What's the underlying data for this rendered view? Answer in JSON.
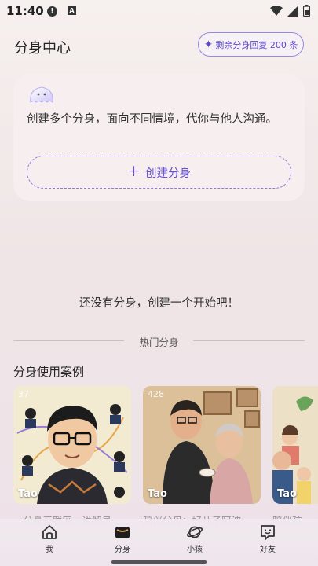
{
  "status_bar": {
    "time": "11:40",
    "badge1": "!",
    "badge2": "A"
  },
  "header": {
    "title": "分身中心",
    "quota_label": "剩余分身回复 200 条"
  },
  "create_card": {
    "description": "创建多个分身，面向不同情境，代你与他人沟通。",
    "button_label": "创建分身"
  },
  "empty_state": {
    "text": "还没有分身，创建一个开始吧！"
  },
  "hot_divider": {
    "label": "热门分身"
  },
  "cases": {
    "title": "分身使用案例",
    "items": [
      {
        "name": "Tao",
        "counter": "37",
        "title": "「分身互联网」讲解员"
      },
      {
        "name": "Tao",
        "counter": "428",
        "title": "陪伴父母：好儿子阿波"
      },
      {
        "name": "Tao",
        "counter": "",
        "title": "陪伴孩"
      }
    ]
  },
  "nav": {
    "items": [
      {
        "label": "我"
      },
      {
        "label": "分身"
      },
      {
        "label": "小猿"
      },
      {
        "label": "好友"
      }
    ],
    "active": "分身"
  },
  "colors": {
    "accent": "#6553d4",
    "border_accent": "#8b79e6"
  }
}
